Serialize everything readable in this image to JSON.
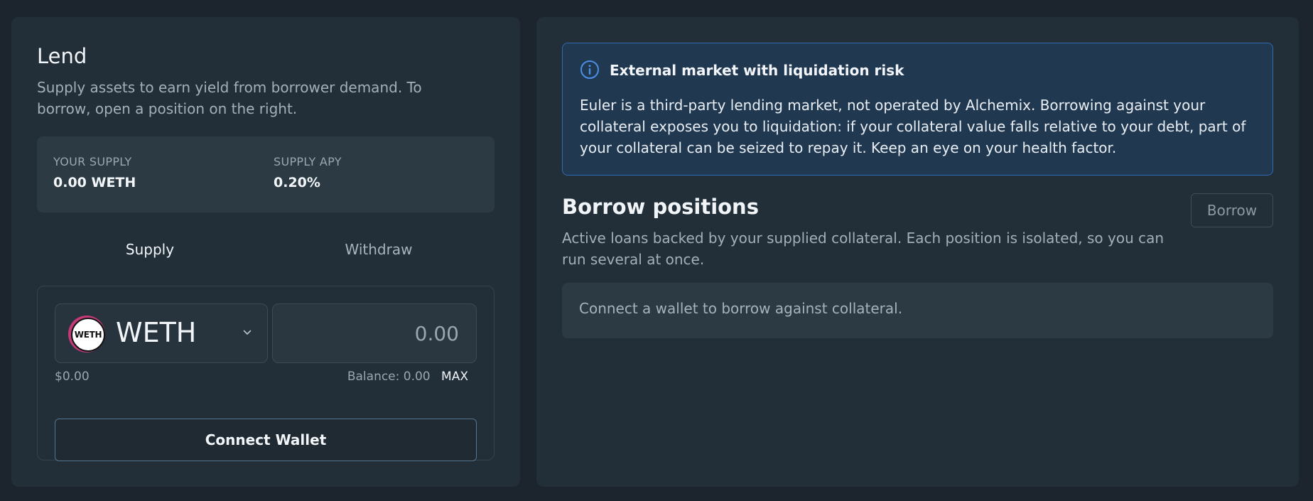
{
  "lend": {
    "title": "Lend",
    "subtitle": "Supply assets to earn yield from borrower demand. To borrow, open a position on the right.",
    "stats": {
      "your_supply_label": "YOUR SUPPLY",
      "your_supply_value": "0.00 WETH",
      "apy_label": "SUPPLY APY",
      "apy_value": "0.20%"
    },
    "tabs": {
      "supply": "Supply",
      "withdraw": "Withdraw",
      "active": "Supply"
    },
    "form": {
      "token_logo_text": "WETH",
      "token_symbol": "WETH",
      "amount_placeholder": "0.00",
      "usd_value": "$0.00",
      "balance_text": "Balance: 0.00",
      "max_label": "MAX",
      "connect_label": "Connect Wallet"
    }
  },
  "borrow": {
    "warning": {
      "title": "External market with liquidation risk",
      "body": "Euler is a third-party lending market, not operated by Alchemix. Borrowing against your collateral exposes you to liquidation: if your collateral value falls relative to your debt, part of your collateral can be seized to repay it. Keep an eye on your health factor."
    },
    "title": "Borrow positions",
    "subtitle": "Active loans backed by your supplied collateral. Each position is isolated, so you can run several at once.",
    "button_label": "Borrow",
    "empty_state": "Connect a wallet to borrow against collateral."
  },
  "icons": {
    "info": "info-icon",
    "chevron": "chevron-down-icon",
    "token": "weth-token-icon"
  },
  "colors": {
    "background": "#1c252d",
    "card": "#222e38",
    "warning_border": "#2f6bb3",
    "warning_bg": "#213851",
    "weth_accent": "#c43a78"
  }
}
